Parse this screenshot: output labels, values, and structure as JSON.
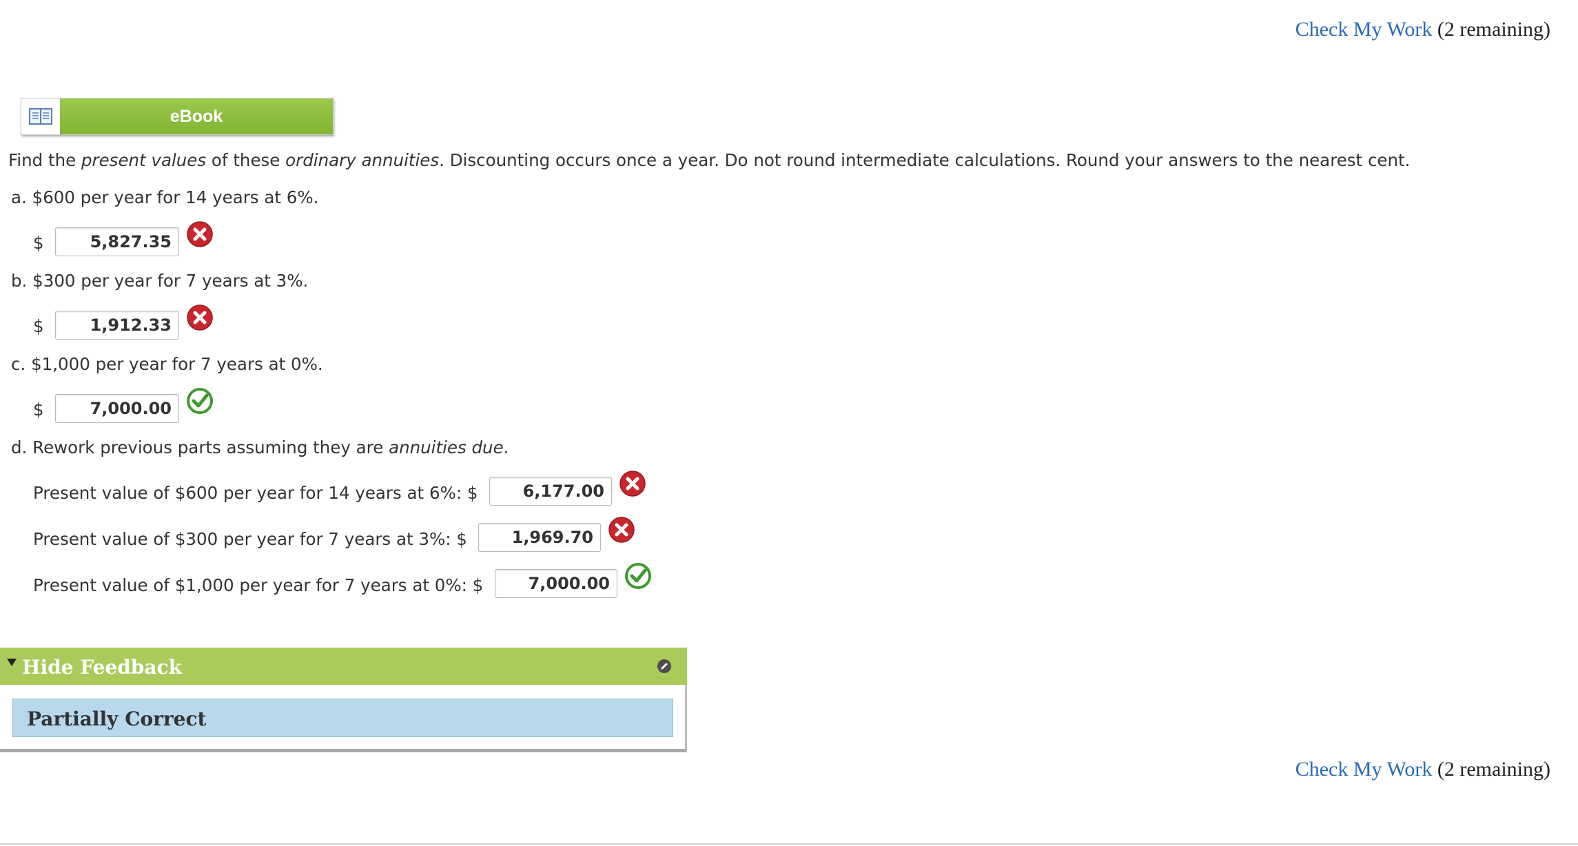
{
  "check_my_work": {
    "link_label": "Check My Work",
    "remaining": "(2 remaining)"
  },
  "ebook": {
    "label": "eBook",
    "icon": "open-book-icon"
  },
  "instructions": {
    "part1": "Find the ",
    "em1": "present values",
    "part2": " of these ",
    "em2": "ordinary annuities",
    "part3": ". Discounting occurs once a year. Do not round intermediate calculations. Round your answers to the nearest cent."
  },
  "questions": [
    {
      "letter": "a.",
      "text": "$600 per year for 14 years at 6%.",
      "currency": "$",
      "answer": "5,827.35",
      "result": "incorrect"
    },
    {
      "letter": "b.",
      "text": "$300 per year for 7 years at 3%.",
      "currency": "$",
      "answer": "1,912.33",
      "result": "incorrect"
    },
    {
      "letter": "c.",
      "text": "$1,000 per year for 7 years at 0%.",
      "currency": "$",
      "answer": "7,000.00",
      "result": "correct"
    }
  ],
  "part_d": {
    "letter": "d.",
    "text_before": "Rework previous parts assuming they are ",
    "em": "annuities due",
    "text_after": ".",
    "rows": [
      {
        "label": "Present value of $600 per year for 14 years at 6%: $",
        "answer": "6,177.00",
        "result": "incorrect"
      },
      {
        "label": "Present value of $300 per year for 7 years at 3%: $",
        "answer": "1,969.70",
        "result": "incorrect"
      },
      {
        "label": "Present value of $1,000 per year for 7 years at 0%: $",
        "answer": "7,000.00",
        "result": "correct"
      }
    ]
  },
  "feedback": {
    "toggle_label": "Hide Feedback",
    "status": "Partially Correct"
  },
  "colors": {
    "link": "#2a6ab5",
    "ebook_green": "#8dbd3a",
    "feedback_header": "#a8cb5a",
    "feedback_body": "#bad8eb",
    "incorrect_red": "#c8262c",
    "correct_green": "#3f9a2e"
  }
}
